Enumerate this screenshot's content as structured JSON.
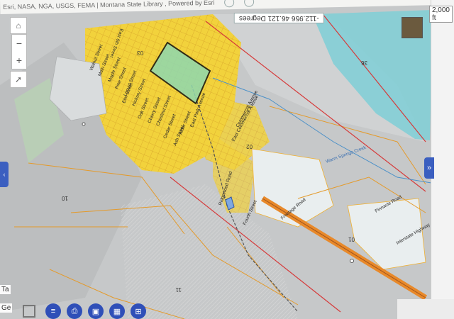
{
  "attribution": "Esri, NASA, NGA, USGS, FEMA | Montana State Library , Powered by Esri",
  "scale_bar": "2,000 ft",
  "coordinates": "-112.956 46.121 Degrees",
  "left_labels": [
    "Ge",
    "Ta"
  ],
  "zoom": {
    "plus": "+",
    "minus": "−"
  },
  "section_numbers": [
    "03",
    "02",
    "36",
    "10",
    "11",
    "01"
  ],
  "street_names": [
    "East 6th Street",
    "Walnut Street",
    "Main Street",
    "Maple Street",
    "Pine Street",
    "Locust Street",
    "Elm Street",
    "Hickory Street",
    "Oak Street",
    "Cherry Street",
    "Chestnut Street",
    "Cedar Street",
    "Ash Street",
    "Alder Street",
    "East Park Avenue",
    "Commercial Avenue",
    "East Commercial Avenue",
    "Warm Springs Creek",
    "Ridgewood Road",
    "Fourth Street",
    "Frontage Road",
    "Pinnacle Road",
    "Interstate Highway"
  ],
  "colors": {
    "terrain": "#c4c6c7",
    "parcel_yellow": "#f2d23c",
    "parcel_line": "#e3a02a",
    "boundary_red": "#d63a3a",
    "selection_green": "#8fd8b0",
    "water_teal": "#7fcfd6",
    "toolbar_blue": "#2f4fb8"
  },
  "toolbar_icons": [
    "layers-icon",
    "print-icon",
    "export-icon",
    "grid-icon",
    "bookmark-icon"
  ]
}
